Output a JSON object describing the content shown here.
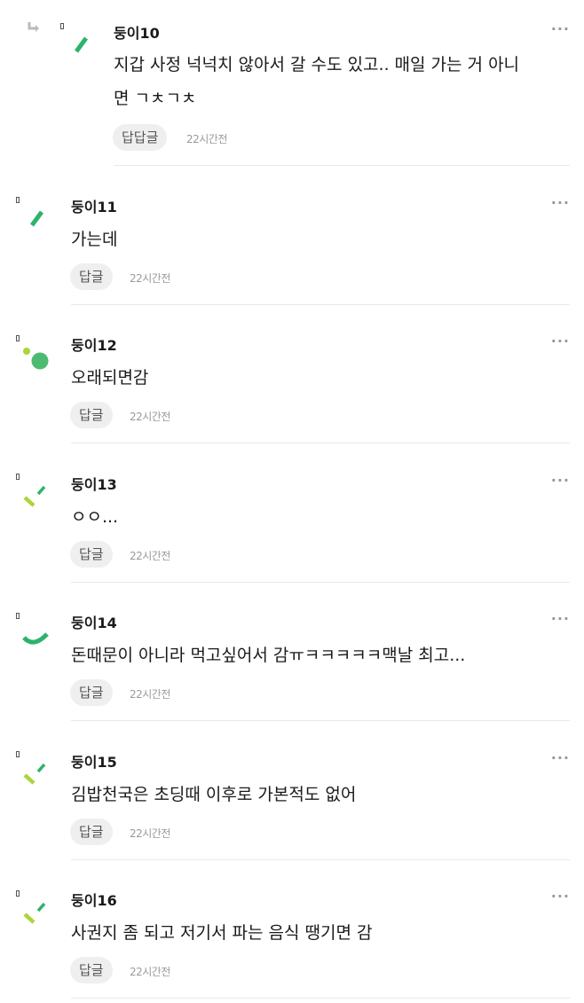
{
  "colors": {
    "green_dark": "#2db36b",
    "green_lime": "#a9d63a",
    "green_mid": "#4cbb71"
  },
  "comments": [
    {
      "username": "둥이10",
      "lines": [
        "지갑 사정 넉넉치 않아서 갈 수도 있고.. 매일 가는 거 아니",
        "면 ㄱㅊㄱㅊ"
      ],
      "reply_label": "답답글",
      "time": "22시간전",
      "avatar_icon": "green-slash-icon",
      "is_reply": true
    },
    {
      "username": "둥이11",
      "lines": [
        "가는데"
      ],
      "reply_label": "답글",
      "time": "22시간전",
      "avatar_icon": "green-slash-icon",
      "is_reply": false
    },
    {
      "username": "둥이12",
      "lines": [
        "오래되면감"
      ],
      "reply_label": "답글",
      "time": "22시간전",
      "avatar_icon": "green-dots-icon",
      "is_reply": false
    },
    {
      "username": "둥이13",
      "lines": [
        "ㅇㅇ..."
      ],
      "reply_label": "답글",
      "time": "22시간전",
      "avatar_icon": "lime-checkmark-icon",
      "is_reply": false
    },
    {
      "username": "둥이14",
      "lines": [
        "돈때문이 아니라 먹고싶어서 감ㅠㅋㅋㅋㅋㅋ맥날 최고..."
      ],
      "reply_label": "답글",
      "time": "22시간전",
      "avatar_icon": "green-arc-icon",
      "is_reply": false
    },
    {
      "username": "둥이15",
      "lines": [
        "김밥천국은 초딩때 이후로 가본적도 없어"
      ],
      "reply_label": "답글",
      "time": "22시간전",
      "avatar_icon": "lime-checkmark-icon",
      "is_reply": false
    },
    {
      "username": "둥이16",
      "lines": [
        "사권지 좀 되고 저기서 파는 음식 땡기면 감"
      ],
      "reply_label": "답글",
      "time": "22시간전",
      "avatar_icon": "lime-checkmark-icon",
      "is_reply": false
    }
  ],
  "more_label": "···"
}
